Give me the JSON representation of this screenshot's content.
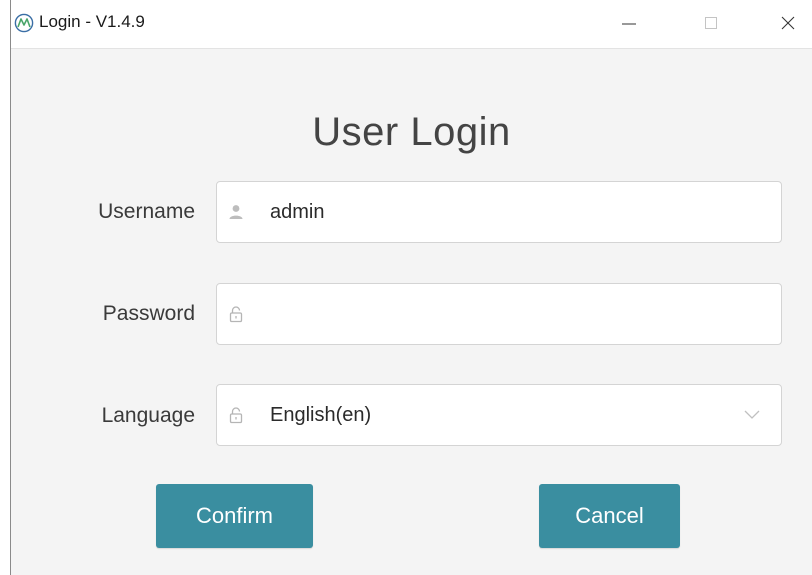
{
  "window": {
    "title": "Login - V1.4.9",
    "icons": {
      "app": "app-logo-icon",
      "minimize": "minimize-icon",
      "maximize": "maximize-icon",
      "close": "close-icon"
    }
  },
  "form": {
    "heading": "User Login",
    "username": {
      "label": "Username",
      "value": "admin",
      "icon": "user-icon"
    },
    "password": {
      "label": "Password",
      "value": "",
      "icon": "lock-icon"
    },
    "language": {
      "label": "Language",
      "value": "English(en)",
      "icon": "lock-icon",
      "dropdown_icon": "chevron-down-icon"
    }
  },
  "buttons": {
    "confirm": "Confirm",
    "cancel": "Cancel"
  },
  "colors": {
    "accent": "#3a8ea0",
    "background": "#f4f4f4",
    "field_border": "#d4d4d4",
    "text": "#3a3a3a"
  }
}
